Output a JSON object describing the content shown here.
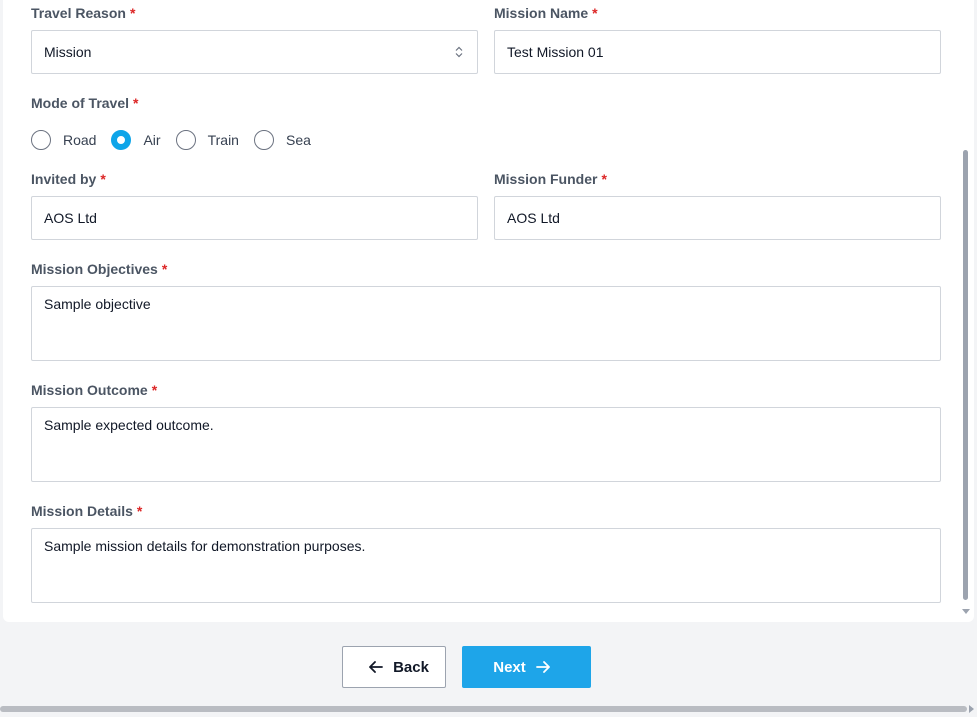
{
  "required_marker": "*",
  "form": {
    "travel_reason": {
      "label": "Travel Reason",
      "value": "Mission"
    },
    "mission_name": {
      "label": "Mission Name",
      "value": "Test Mission 01"
    },
    "mode_of_travel": {
      "label": "Mode of Travel",
      "options": [
        "Road",
        "Air",
        "Train",
        "Sea"
      ],
      "selected": "Air"
    },
    "invited_by": {
      "label": "Invited by",
      "value": "AOS Ltd"
    },
    "mission_funder": {
      "label": "Mission Funder",
      "value": "AOS Ltd"
    },
    "mission_objectives": {
      "label": "Mission Objectives",
      "value": "Sample objective"
    },
    "mission_outcome": {
      "label": "Mission Outcome",
      "value": "Sample expected outcome."
    },
    "mission_details": {
      "label": "Mission Details",
      "value": "Sample mission details for demonstration purposes."
    }
  },
  "buttons": {
    "back": "Back",
    "next": "Next"
  },
  "colors": {
    "accent": "#1ea5e9",
    "required": "#dc2626"
  }
}
